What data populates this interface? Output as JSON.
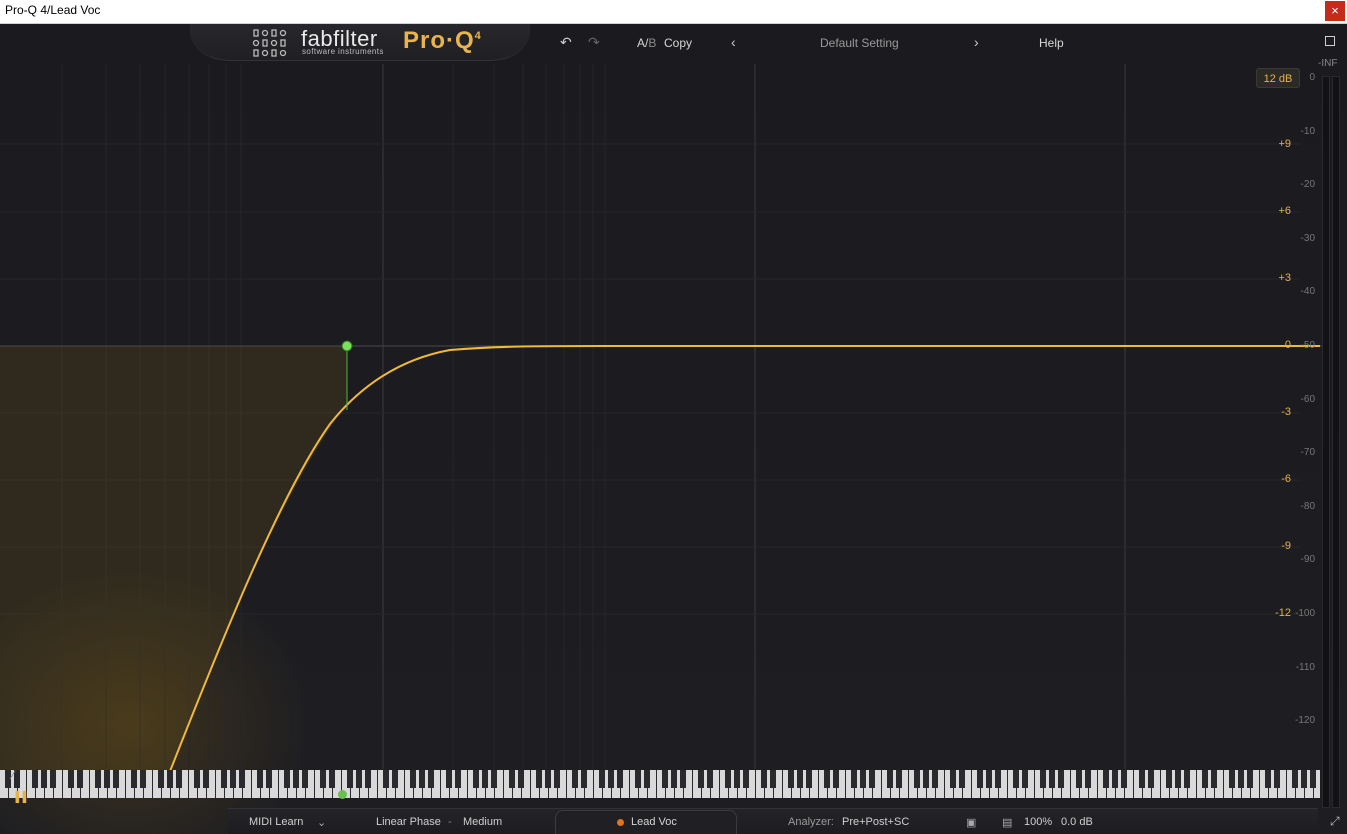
{
  "window": {
    "title": "Pro-Q 4/Lead Voc",
    "close_label": "×"
  },
  "header": {
    "brand": "fabfilter",
    "brand_sub": "software instruments",
    "product": "Pro·Q",
    "product_version": "4",
    "ab_a": "A/",
    "ab_b": "B",
    "copy_label": "Copy",
    "preset_name": "Default Setting",
    "help_label": "Help",
    "undo_icon": "undo-icon",
    "redo_icon": "redo-icon",
    "prev_icon": "chevron-left-icon",
    "next_icon": "chevron-right-icon",
    "fullscreen_icon": "fullscreen-icon"
  },
  "display": {
    "range_label": "12 dB",
    "inf_label": "-INF",
    "gain_scale": [
      {
        "label": "+9",
        "db": 9
      },
      {
        "label": "+6",
        "db": 6
      },
      {
        "label": "+3",
        "db": 3
      },
      {
        "label": "0",
        "db": 0
      },
      {
        "label": "-3",
        "db": -3
      },
      {
        "label": "-6",
        "db": -6
      },
      {
        "label": "-9",
        "db": -9
      },
      {
        "label": "-12",
        "db": -12
      }
    ],
    "analyzer_scale": [
      {
        "label": "0",
        "db": 0
      },
      {
        "label": "-10",
        "db": -10
      },
      {
        "label": "-20",
        "db": -20
      },
      {
        "label": "-30",
        "db": -30
      },
      {
        "label": "-40",
        "db": -40
      },
      {
        "label": "-50",
        "db": -50
      },
      {
        "label": "-60",
        "db": -60
      },
      {
        "label": "-70",
        "db": -70
      },
      {
        "label": "-80",
        "db": -80
      },
      {
        "label": "-90",
        "db": -90
      },
      {
        "label": "-100",
        "db": -100
      },
      {
        "label": "-110",
        "db": -110
      },
      {
        "label": "-120",
        "db": -120
      }
    ],
    "colors": {
      "curve": "#f0b93a",
      "band_node": "#7be05a",
      "gain_text": "#e6b24a"
    }
  },
  "bottom": {
    "midi_learn": "MIDI Learn",
    "processing_mode": "Linear Phase",
    "separator": "-",
    "latency_mode": "Medium",
    "channel_name": "Lead Voc",
    "analyzer_label": "Analyzer:",
    "analyzer_value": "Pre+Post+SC",
    "zoom": "100%",
    "output_gain": "0.0 dB"
  }
}
